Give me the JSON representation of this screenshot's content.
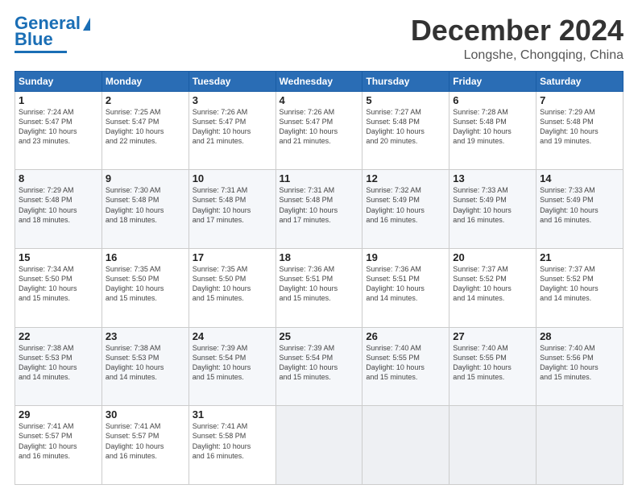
{
  "logo": {
    "line1": "General",
    "line2": "Blue"
  },
  "title": "December 2024",
  "location": "Longshe, Chongqing, China",
  "weekdays": [
    "Sunday",
    "Monday",
    "Tuesday",
    "Wednesday",
    "Thursday",
    "Friday",
    "Saturday"
  ],
  "weeks": [
    [
      {
        "day": "1",
        "info": "Sunrise: 7:24 AM\nSunset: 5:47 PM\nDaylight: 10 hours\nand 23 minutes."
      },
      {
        "day": "2",
        "info": "Sunrise: 7:25 AM\nSunset: 5:47 PM\nDaylight: 10 hours\nand 22 minutes."
      },
      {
        "day": "3",
        "info": "Sunrise: 7:26 AM\nSunset: 5:47 PM\nDaylight: 10 hours\nand 21 minutes."
      },
      {
        "day": "4",
        "info": "Sunrise: 7:26 AM\nSunset: 5:47 PM\nDaylight: 10 hours\nand 21 minutes."
      },
      {
        "day": "5",
        "info": "Sunrise: 7:27 AM\nSunset: 5:48 PM\nDaylight: 10 hours\nand 20 minutes."
      },
      {
        "day": "6",
        "info": "Sunrise: 7:28 AM\nSunset: 5:48 PM\nDaylight: 10 hours\nand 19 minutes."
      },
      {
        "day": "7",
        "info": "Sunrise: 7:29 AM\nSunset: 5:48 PM\nDaylight: 10 hours\nand 19 minutes."
      }
    ],
    [
      {
        "day": "8",
        "info": "Sunrise: 7:29 AM\nSunset: 5:48 PM\nDaylight: 10 hours\nand 18 minutes."
      },
      {
        "day": "9",
        "info": "Sunrise: 7:30 AM\nSunset: 5:48 PM\nDaylight: 10 hours\nand 18 minutes."
      },
      {
        "day": "10",
        "info": "Sunrise: 7:31 AM\nSunset: 5:48 PM\nDaylight: 10 hours\nand 17 minutes."
      },
      {
        "day": "11",
        "info": "Sunrise: 7:31 AM\nSunset: 5:48 PM\nDaylight: 10 hours\nand 17 minutes."
      },
      {
        "day": "12",
        "info": "Sunrise: 7:32 AM\nSunset: 5:49 PM\nDaylight: 10 hours\nand 16 minutes."
      },
      {
        "day": "13",
        "info": "Sunrise: 7:33 AM\nSunset: 5:49 PM\nDaylight: 10 hours\nand 16 minutes."
      },
      {
        "day": "14",
        "info": "Sunrise: 7:33 AM\nSunset: 5:49 PM\nDaylight: 10 hours\nand 16 minutes."
      }
    ],
    [
      {
        "day": "15",
        "info": "Sunrise: 7:34 AM\nSunset: 5:50 PM\nDaylight: 10 hours\nand 15 minutes."
      },
      {
        "day": "16",
        "info": "Sunrise: 7:35 AM\nSunset: 5:50 PM\nDaylight: 10 hours\nand 15 minutes."
      },
      {
        "day": "17",
        "info": "Sunrise: 7:35 AM\nSunset: 5:50 PM\nDaylight: 10 hours\nand 15 minutes."
      },
      {
        "day": "18",
        "info": "Sunrise: 7:36 AM\nSunset: 5:51 PM\nDaylight: 10 hours\nand 15 minutes."
      },
      {
        "day": "19",
        "info": "Sunrise: 7:36 AM\nSunset: 5:51 PM\nDaylight: 10 hours\nand 14 minutes."
      },
      {
        "day": "20",
        "info": "Sunrise: 7:37 AM\nSunset: 5:52 PM\nDaylight: 10 hours\nand 14 minutes."
      },
      {
        "day": "21",
        "info": "Sunrise: 7:37 AM\nSunset: 5:52 PM\nDaylight: 10 hours\nand 14 minutes."
      }
    ],
    [
      {
        "day": "22",
        "info": "Sunrise: 7:38 AM\nSunset: 5:53 PM\nDaylight: 10 hours\nand 14 minutes."
      },
      {
        "day": "23",
        "info": "Sunrise: 7:38 AM\nSunset: 5:53 PM\nDaylight: 10 hours\nand 14 minutes."
      },
      {
        "day": "24",
        "info": "Sunrise: 7:39 AM\nSunset: 5:54 PM\nDaylight: 10 hours\nand 15 minutes."
      },
      {
        "day": "25",
        "info": "Sunrise: 7:39 AM\nSunset: 5:54 PM\nDaylight: 10 hours\nand 15 minutes."
      },
      {
        "day": "26",
        "info": "Sunrise: 7:40 AM\nSunset: 5:55 PM\nDaylight: 10 hours\nand 15 minutes."
      },
      {
        "day": "27",
        "info": "Sunrise: 7:40 AM\nSunset: 5:55 PM\nDaylight: 10 hours\nand 15 minutes."
      },
      {
        "day": "28",
        "info": "Sunrise: 7:40 AM\nSunset: 5:56 PM\nDaylight: 10 hours\nand 15 minutes."
      }
    ],
    [
      {
        "day": "29",
        "info": "Sunrise: 7:41 AM\nSunset: 5:57 PM\nDaylight: 10 hours\nand 16 minutes."
      },
      {
        "day": "30",
        "info": "Sunrise: 7:41 AM\nSunset: 5:57 PM\nDaylight: 10 hours\nand 16 minutes."
      },
      {
        "day": "31",
        "info": "Sunrise: 7:41 AM\nSunset: 5:58 PM\nDaylight: 10 hours\nand 16 minutes."
      },
      {
        "day": "",
        "info": ""
      },
      {
        "day": "",
        "info": ""
      },
      {
        "day": "",
        "info": ""
      },
      {
        "day": "",
        "info": ""
      }
    ]
  ]
}
